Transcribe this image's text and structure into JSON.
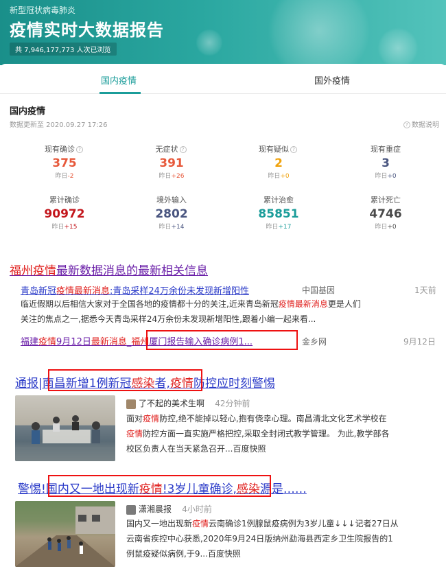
{
  "banner": {
    "subtitle": "新型冠状病毒肺炎",
    "title": "疫情实时大数据报告",
    "views": "共 7,946,177,773 人次已浏览"
  },
  "tabs": [
    "国内疫情",
    "国外疫情"
  ],
  "domestic": {
    "title": "国内疫情",
    "updated": "数据更新至 2020.09.27 17:26",
    "explain": "数据说明",
    "stats_row1": [
      {
        "label": "现有确诊",
        "value": "375",
        "delta_prefix": "昨日",
        "delta": "-2",
        "color": "#e7593b"
      },
      {
        "label": "无症状",
        "value": "391",
        "delta_prefix": "昨日",
        "delta": "+26",
        "color": "#e7593b"
      },
      {
        "label": "现有疑似",
        "value": "2",
        "delta_prefix": "昨日",
        "delta": "+0",
        "color": "#f0a20c"
      },
      {
        "label": "现有重症",
        "value": "3",
        "delta_prefix": "昨日",
        "delta": "+0",
        "color": "#4a5680"
      }
    ],
    "stats_row2": [
      {
        "label": "累计确诊",
        "value": "90972",
        "delta_prefix": "昨日",
        "delta": "+15",
        "color": "#c3161c"
      },
      {
        "label": "境外输入",
        "value": "2802",
        "delta_prefix": "昨日",
        "delta": "+14",
        "color": "#4a5680"
      },
      {
        "label": "累计治愈",
        "value": "85851",
        "delta_prefix": "昨日",
        "delta": "+17",
        "color": "#1b9d9a"
      },
      {
        "label": "累计死亡",
        "value": "4746",
        "delta_prefix": "昨日",
        "delta": "+0",
        "color": "#4a4a4a"
      }
    ]
  },
  "result1": {
    "title_a": "福州",
    "title_b": "疫情",
    "title_c": "最新数据消息的最新相关信息",
    "item1": {
      "title_a": "青岛新冠",
      "title_b": "疫情最新消息",
      "title_c": ":青岛采样24万余份未发现新增阳性",
      "source": "中国基因",
      "time": "1天前",
      "snippet_1a": "临近假期以后相信大家对于全国各地的疫情都十分的关注,近来青岛新冠",
      "snippet_1b": "疫情最新消息",
      "snippet_1c": "更是人们",
      "snippet_2": "关注的焦点之一,据悉今天青岛采样24万余份未发现新增阳性,跟着小编一起来看..."
    },
    "item2": {
      "title_a": "福建",
      "title_b": "疫情",
      "title_c": "9月12日",
      "title_d": "最新消息",
      "title_e": "_",
      "title_f": "福州",
      "title_g": "厦门报告输入确诊病例1...",
      "source": "金乡网",
      "time": "9月12日"
    }
  },
  "result2": {
    "title_a": "通报|南昌新增1例新冠",
    "title_b": "感染",
    "title_c": "者,",
    "title_d": "疫情",
    "title_e": "防控应时刻警惕",
    "author": "了不起的美术生啊",
    "time": "42分钟前",
    "snippet_1a": "面对",
    "snippet_1b": "疫情",
    "snippet_1c": "防控,绝不能掉以轻心,抱有侥幸心理。南昌清北文化艺术学校在",
    "snippet_2a": "疫情",
    "snippet_2b": "防控方面一直实施严格把控,采取全封闭式教学管理。 为此,教学部各",
    "snippet_3": "校区负责人在当天紧急召开...百度快照"
  },
  "result3": {
    "title_a": "警惕!国内又一地出现新",
    "title_b": "疫情",
    "title_c": "!3岁儿童确诊,",
    "title_d": "感染",
    "title_e": "源是……",
    "author": "潇湘晨报",
    "time": "4小时前",
    "snippet_1a": "国内又一地出现新",
    "snippet_1b": "疫情",
    "snippet_1c": "云南确诊1例腺鼠疫病例为3岁儿童↓↓↓记者27日从",
    "snippet_2": "云南省疾控中心获悉,2020年9月24日版纳州勐海县西定乡卫生院报告的1",
    "snippet_3": "例鼠疫疑似病例,于9...百度快照"
  }
}
